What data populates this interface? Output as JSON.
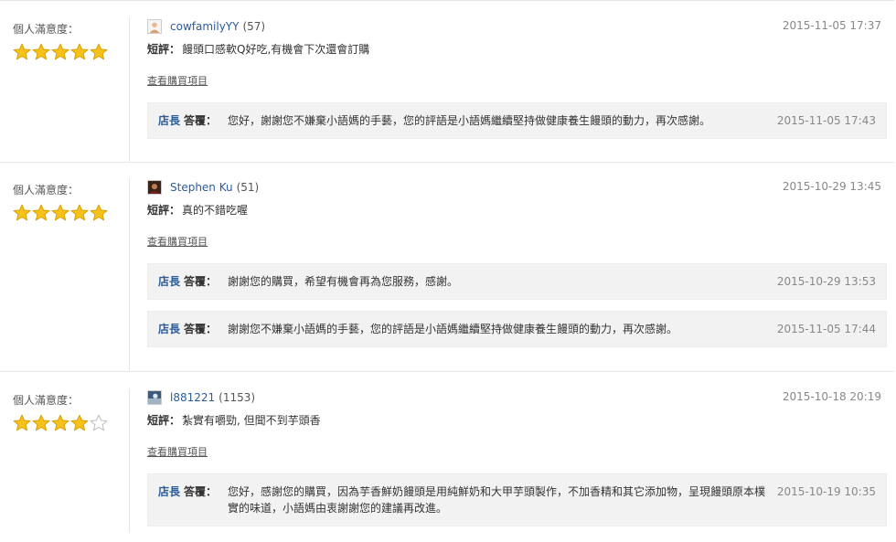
{
  "labels": {
    "satisfaction": "個人滿意度：",
    "short_review": "短評：",
    "view_purchase": "查看購買項目",
    "shop_owner": "店長",
    "reply": "答覆："
  },
  "colors": {
    "link": "#2b5c9a",
    "star_fill": "#f5c21b",
    "star_empty": "#ffffff",
    "reply_bg": "#f2f2f2",
    "date": "#888888"
  },
  "reviews": [
    {
      "rating": 5,
      "avatar_icon": "default-user-avatar-icon",
      "username": "cowfamilyYY",
      "count": "(57)",
      "date": "2015-11-05 17:37",
      "text": "饅頭口感軟Q好吃,有機會下次還會訂購",
      "replies": [
        {
          "text": "您好，謝謝您不嫌棄小語媽的手藝，您的評語是小語媽繼續堅持做健康養生饅頭的動力，再次感謝。",
          "date": "2015-11-05 17:43"
        }
      ]
    },
    {
      "rating": 5,
      "avatar_icon": "user-photo-avatar-icon",
      "username": "Stephen Ku",
      "count": "(51)",
      "date": "2015-10-29 13:45",
      "text": "真的不錯吃喔",
      "replies": [
        {
          "text": "謝謝您的購買，希望有機會再為您服務，感謝。",
          "date": "2015-10-29 13:53"
        },
        {
          "text": "謝謝您不嫌棄小語媽的手藝，您的評語是小語媽繼續堅持做健康養生饅頭的動力，再次感謝。",
          "date": "2015-11-05 17:44"
        }
      ]
    },
    {
      "rating": 4,
      "avatar_icon": "user-photo-avatar-icon",
      "username": "l881221",
      "count": "(1153)",
      "date": "2015-10-18 20:19",
      "text": "紮實有嚼勁, 但聞不到芋頭香",
      "replies": [
        {
          "text": "您好，感謝您的購買，因為芋香鮮奶饅頭是用純鮮奶和大甲芋頭製作，不加香精和其它添加物，呈現饅頭原本樸實的味道，小語媽由衷謝謝您的建議再改進。",
          "date": "2015-10-19 10:35"
        }
      ]
    }
  ]
}
